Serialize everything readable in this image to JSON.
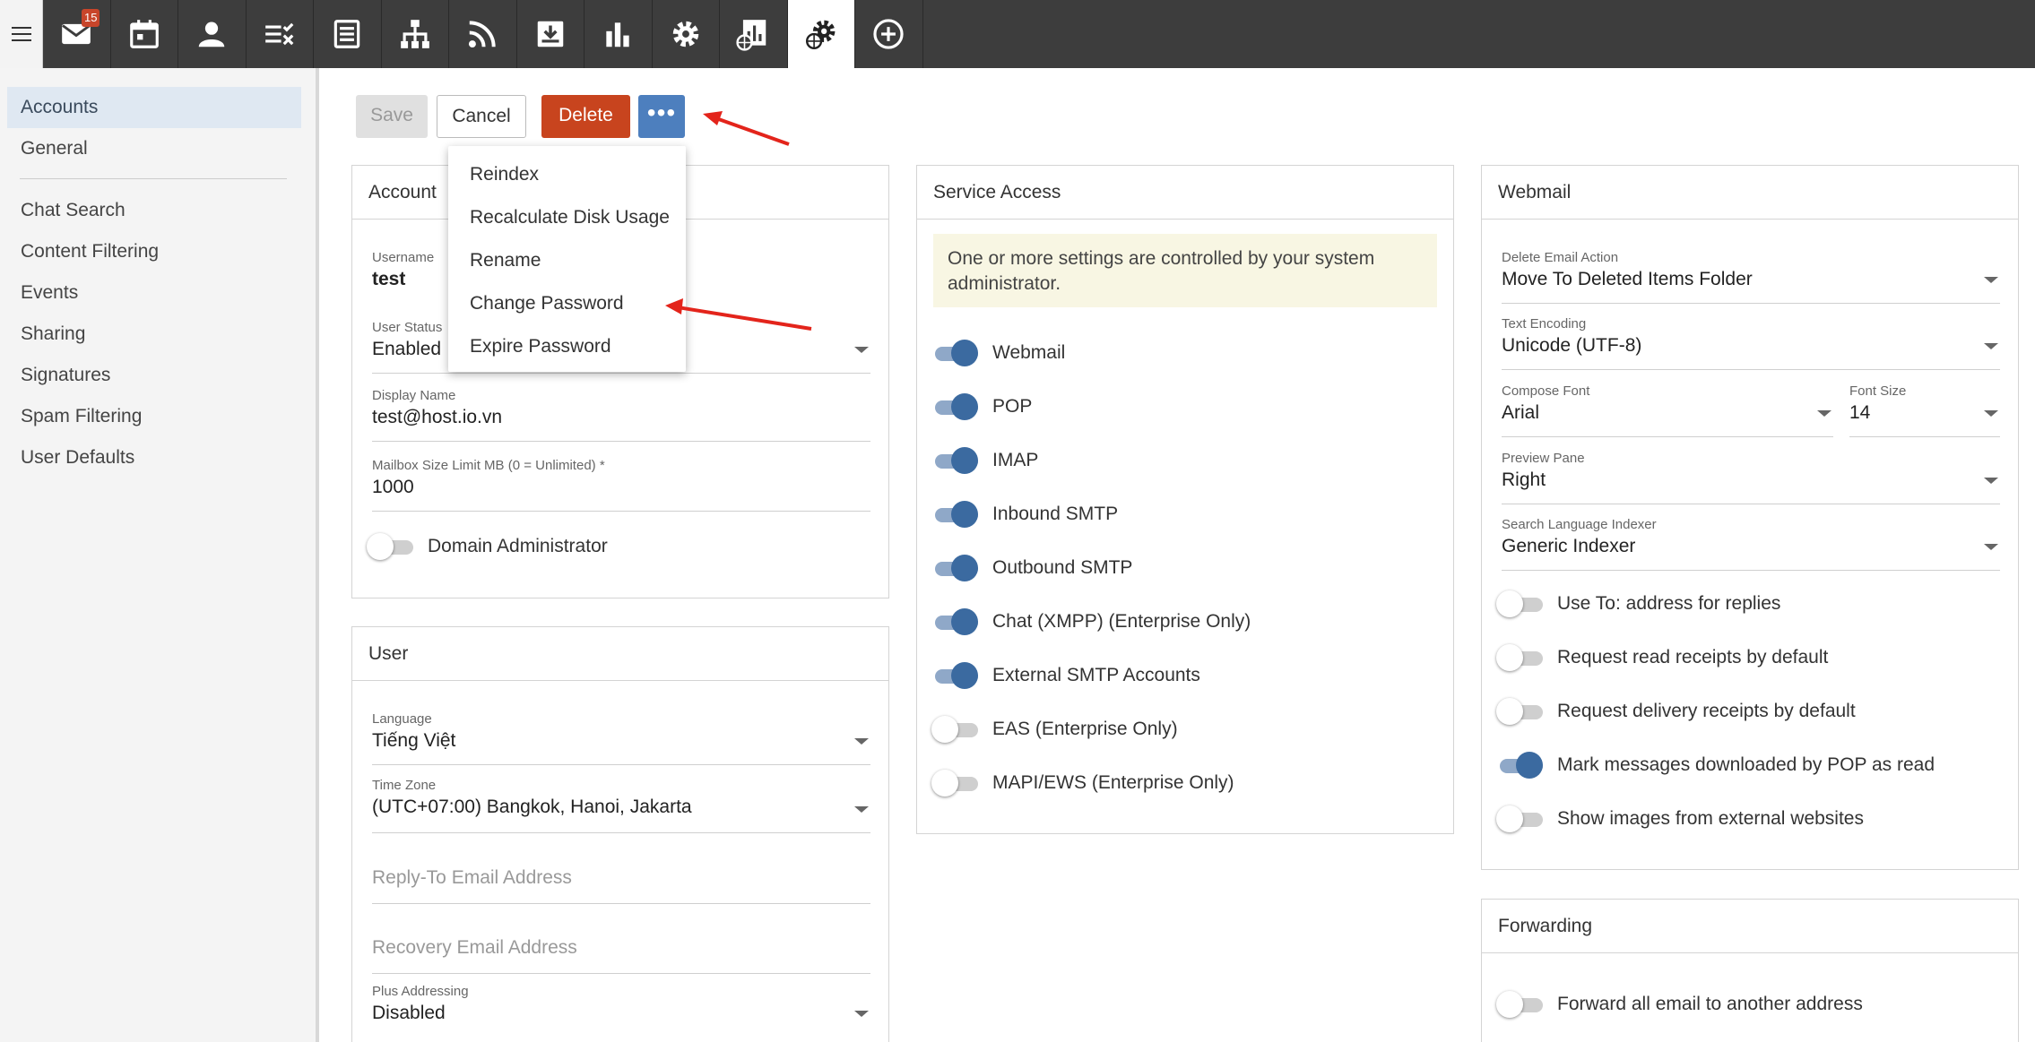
{
  "topbar": {
    "mail_badge": "15",
    "nav": [
      {
        "name": "mail-icon"
      },
      {
        "name": "calendar-icon"
      },
      {
        "name": "contacts-icon"
      },
      {
        "name": "tasks-icon"
      },
      {
        "name": "notes-icon"
      },
      {
        "name": "sitemap-icon"
      },
      {
        "name": "rss-icon"
      },
      {
        "name": "download-icon"
      },
      {
        "name": "reports-icon"
      },
      {
        "name": "gear-icon"
      },
      {
        "name": "domain-reports-icon"
      },
      {
        "name": "domain-settings-icon"
      },
      {
        "name": "add-icon"
      }
    ]
  },
  "sidebar": {
    "items": [
      "Accounts",
      "General",
      "Chat Search",
      "Content Filtering",
      "Events",
      "Sharing",
      "Signatures",
      "Spam Filtering",
      "User Defaults"
    ]
  },
  "toolbar": {
    "save": "Save",
    "cancel": "Cancel",
    "delete": "Delete",
    "more": "•••"
  },
  "menu": {
    "items": [
      "Reindex",
      "Recalculate Disk Usage",
      "Rename",
      "Change Password",
      "Expire Password"
    ]
  },
  "account": {
    "title": "Account",
    "username_label": "Username",
    "username": "test",
    "status_label": "User Status",
    "status": "Enabled",
    "display_label": "Display Name",
    "display": "test@host.io.vn",
    "mailbox_label": "Mailbox Size Limit MB (0 = Unlimited) *",
    "mailbox": "1000",
    "domain_admin": "Domain Administrator"
  },
  "user": {
    "title": "User",
    "language_label": "Language",
    "language": "Tiếng Việt",
    "timezone_label": "Time Zone",
    "timezone": "(UTC+07:00) Bangkok, Hanoi, Jakarta",
    "replyto_placeholder": "Reply-To Email Address",
    "recovery_placeholder": "Recovery Email Address",
    "plus_label": "Plus Addressing",
    "plus": "Disabled"
  },
  "service": {
    "title": "Service Access",
    "notice": "One or more settings are controlled by your system administrator.",
    "toggles": [
      {
        "label": "Webmail",
        "on": true
      },
      {
        "label": "POP",
        "on": true
      },
      {
        "label": "IMAP",
        "on": true
      },
      {
        "label": "Inbound SMTP",
        "on": true
      },
      {
        "label": "Outbound SMTP",
        "on": true
      },
      {
        "label": "Chat (XMPP) (Enterprise Only)",
        "on": true
      },
      {
        "label": "External SMTP Accounts",
        "on": true
      },
      {
        "label": "EAS (Enterprise Only)",
        "on": false
      },
      {
        "label": "MAPI/EWS (Enterprise Only)",
        "on": false
      }
    ]
  },
  "webmail": {
    "title": "Webmail",
    "delete_action_label": "Delete Email Action",
    "delete_action": "Move To Deleted Items Folder",
    "encoding_label": "Text Encoding",
    "encoding": "Unicode (UTF-8)",
    "font_label": "Compose Font",
    "font": "Arial",
    "size_label": "Font Size",
    "size": "14",
    "preview_label": "Preview Pane",
    "preview": "Right",
    "indexer_label": "Search Language Indexer",
    "indexer": "Generic Indexer",
    "toggles": [
      {
        "label": "Use To: address for replies",
        "on": false
      },
      {
        "label": "Request read receipts by default",
        "on": false
      },
      {
        "label": "Request delivery receipts by default",
        "on": false
      },
      {
        "label": "Mark messages downloaded by POP as read",
        "on": true
      },
      {
        "label": "Show images from external websites",
        "on": false
      }
    ]
  },
  "forwarding": {
    "title": "Forwarding",
    "forward_all": "Forward all email to another address"
  },
  "colors": {
    "accent": "#3b6aa0",
    "delete": "#c8441e",
    "arrow": "#e3241b"
  }
}
